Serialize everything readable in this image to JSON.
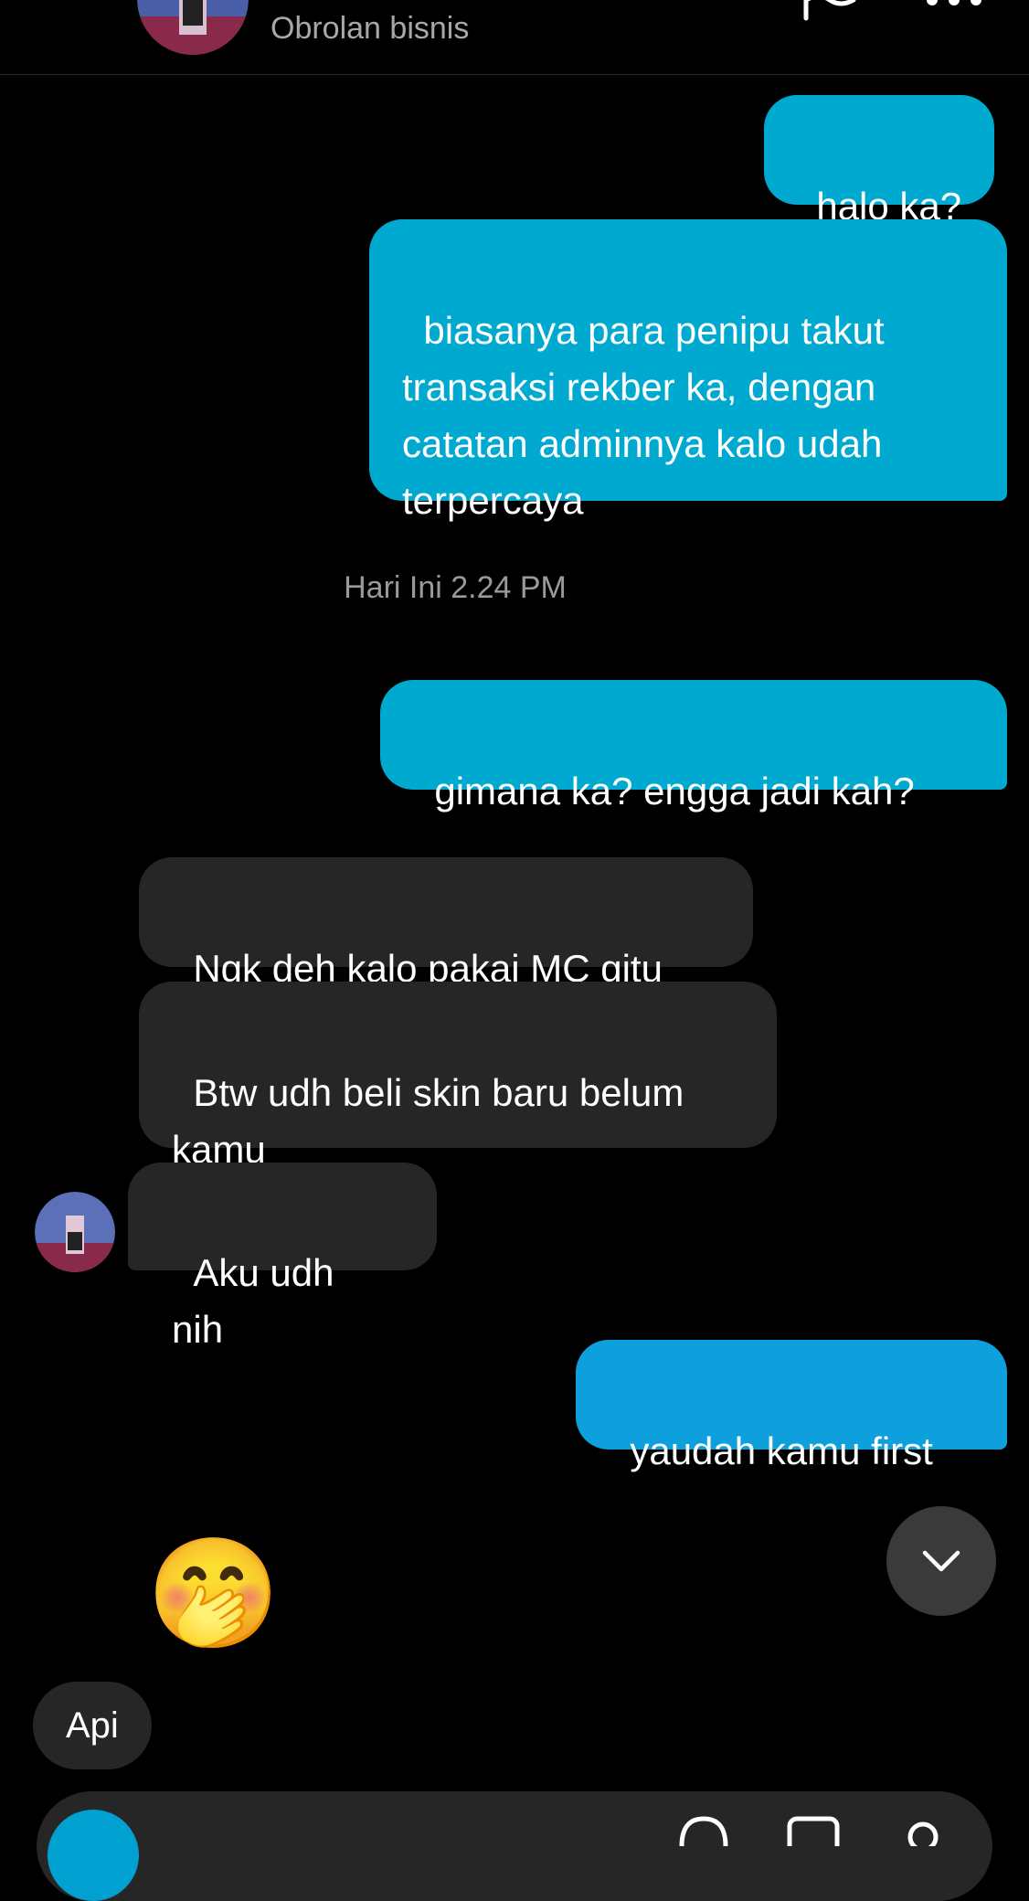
{
  "header": {
    "subtitle": "Obrolan bisnis"
  },
  "messages": [
    {
      "direction": "out",
      "text": "halo ka?"
    },
    {
      "direction": "out",
      "text": "biasanya para penipu takut transaksi rekber ka, dengan catatan adminnya kalo udah terpercaya"
    },
    {
      "direction": "out",
      "text": "gimana ka? engga jadi kah?"
    },
    {
      "direction": "in",
      "text": "Ngk deh kalo pakai MC gitu"
    },
    {
      "direction": "in",
      "text": "Btw udh beli skin baru belum kamu"
    },
    {
      "direction": "in",
      "text": "Aku udh nih"
    },
    {
      "direction": "out",
      "text": "yaudah kamu first"
    }
  ],
  "timestamp": "Hari Ini 2.24 PM",
  "reaction_emoji": "🤭",
  "quick_reply": {
    "label": "Api"
  },
  "icons": {
    "back": "chevron-left-icon",
    "flag": "flag-icon",
    "more": "more-dots-icon",
    "scroll": "chevron-down-icon"
  },
  "colors": {
    "outgoing_bubble": "#00a9cf",
    "incoming_bubble": "#262626",
    "background": "#000000"
  }
}
